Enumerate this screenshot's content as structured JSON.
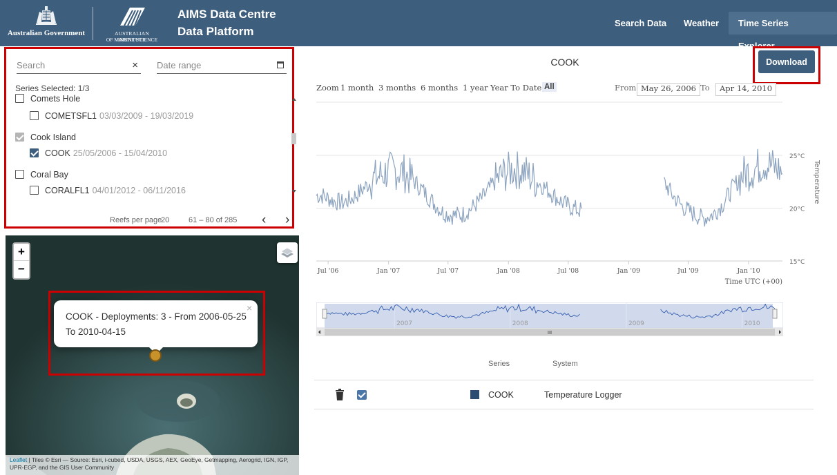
{
  "header": {
    "gov_logo_text": "Australian Government",
    "aims_line1": "AUSTRALIAN INSTITUTE",
    "aims_line2": "OF MARINE SCIENCE",
    "title_line1": "AIMS Data Centre",
    "title_line2": "Data Platform",
    "nav": [
      "Search Data",
      "Weather",
      "Time Series Explorer"
    ],
    "active_nav": "Time Series Explorer",
    "color": "#3d5e7d"
  },
  "left_panel": {
    "search_placeholder": "Search",
    "clear_symbol": "×",
    "date_placeholder": "Date range",
    "series_selected": "Series Selected: 1/3",
    "reefs": [
      {
        "name": "Comets Hole",
        "checked": false,
        "series": [
          {
            "code": "COMETSFL1",
            "dates": "03/03/2009 - 19/03/2019",
            "checked": false
          }
        ]
      },
      {
        "name": "Cook Island",
        "checked": true,
        "series": [
          {
            "code": "COOK",
            "dates": "25/05/2006 - 15/04/2010",
            "checked": true
          }
        ]
      },
      {
        "name": "Coral Bay",
        "checked": false,
        "series": [
          {
            "code": "CORALFL1",
            "dates": "04/01/2012 - 06/11/2016",
            "checked": false
          }
        ]
      }
    ],
    "pager": {
      "label": "Reefs per page",
      "per_page": "20",
      "range": "61 – 80 of 285",
      "prev": "‹",
      "next": "›"
    }
  },
  "map": {
    "zoom_in": "+",
    "zoom_out": "−",
    "popup_text": "COOK - Deployments: 3 - From 2006-05-25 To 2010-04-15",
    "popup_close": "×",
    "attribution_link": "Leaflet",
    "attribution_text": " | Tiles © Esri — Source: Esri, i-cubed, USDA, USGS, AEX, GeoEye, Getmapping, Aerogrid, IGN, IGP, UPR-EGP, and the GIS User Community",
    "marker_color": "#c8922a"
  },
  "chart_panel": {
    "title": "COOK",
    "download_label": "Download",
    "zoom_label": "Zoom",
    "zoom_options": [
      "1 month",
      "3 months",
      "6 months",
      "1 year",
      "Year To Date",
      "All"
    ],
    "selected_zoom": "All",
    "from_label": "From",
    "from_value": "May 26, 2006",
    "to_label": "To",
    "to_value": "Apr 14, 2010"
  },
  "chart_data": {
    "type": "line",
    "series": [
      {
        "name": "COOK",
        "color": "#8ca3bf"
      }
    ],
    "xlabel": "Time UTC (+00)",
    "ylabel": "Temperature",
    "x_ticks": [
      "Jul '06",
      "Jan '07",
      "Jul '07",
      "Jan '08",
      "Jul '08",
      "Jan '09",
      "Jul '09",
      "Jan '10"
    ],
    "y_ticks": [
      "25°C",
      "20°C",
      "15°C"
    ],
    "xlim": [
      "2006-05-26",
      "2010-04-14"
    ],
    "ylim": [
      15,
      25
    ],
    "gaps": [
      [
        "2008-08-12",
        "2009-04-18"
      ]
    ],
    "monthly_values": [
      {
        "x": "2006-06",
        "y": 21.2
      },
      {
        "x": "2006-07",
        "y": 20.7
      },
      {
        "x": "2006-08",
        "y": 20.5
      },
      {
        "x": "2006-09",
        "y": 21.0
      },
      {
        "x": "2006-10",
        "y": 21.8
      },
      {
        "x": "2006-11",
        "y": 22.7
      },
      {
        "x": "2006-12",
        "y": 23.3
      },
      {
        "x": "2007-01",
        "y": 23.6
      },
      {
        "x": "2007-02",
        "y": 23.4
      },
      {
        "x": "2007-03",
        "y": 22.7
      },
      {
        "x": "2007-04",
        "y": 21.7
      },
      {
        "x": "2007-05",
        "y": 20.6
      },
      {
        "x": "2007-06",
        "y": 19.6
      },
      {
        "x": "2007-07",
        "y": 19.3
      },
      {
        "x": "2007-08",
        "y": 19.4
      },
      {
        "x": "2007-09",
        "y": 20.1
      },
      {
        "x": "2007-10",
        "y": 21.0
      },
      {
        "x": "2007-11",
        "y": 22.3
      },
      {
        "x": "2007-12",
        "y": 23.2
      },
      {
        "x": "2008-01",
        "y": 23.7
      },
      {
        "x": "2008-02",
        "y": 23.5
      },
      {
        "x": "2008-03",
        "y": 22.8
      },
      {
        "x": "2008-04",
        "y": 22.1
      },
      {
        "x": "2008-05",
        "y": 21.3
      },
      {
        "x": "2008-06",
        "y": 20.5
      },
      {
        "x": "2008-07",
        "y": 20.0
      },
      {
        "x": "2008-08",
        "y": 19.7
      },
      {
        "x": "2009-04",
        "y": 22.6
      },
      {
        "x": "2009-05",
        "y": 21.2
      },
      {
        "x": "2009-06",
        "y": 20.1
      },
      {
        "x": "2009-07",
        "y": 19.5
      },
      {
        "x": "2009-08",
        "y": 19.0
      },
      {
        "x": "2009-09",
        "y": 19.4
      },
      {
        "x": "2009-10",
        "y": 20.4
      },
      {
        "x": "2009-11",
        "y": 22.0
      },
      {
        "x": "2009-12",
        "y": 23.2
      },
      {
        "x": "2010-01",
        "y": 23.6
      },
      {
        "x": "2010-02",
        "y": 24.3
      },
      {
        "x": "2010-03",
        "y": 24.0
      },
      {
        "x": "2010-04",
        "y": 23.4
      }
    ],
    "navigator_ticks": [
      "2007",
      "2008",
      "2009",
      "2010"
    ],
    "navigator_scroll_symbol": "III"
  },
  "series_table": {
    "headers": [
      "Series",
      "System"
    ],
    "rows": [
      {
        "name": "COOK",
        "system": "Temperature Logger",
        "color": "#2c4c72",
        "checked": true
      }
    ]
  }
}
